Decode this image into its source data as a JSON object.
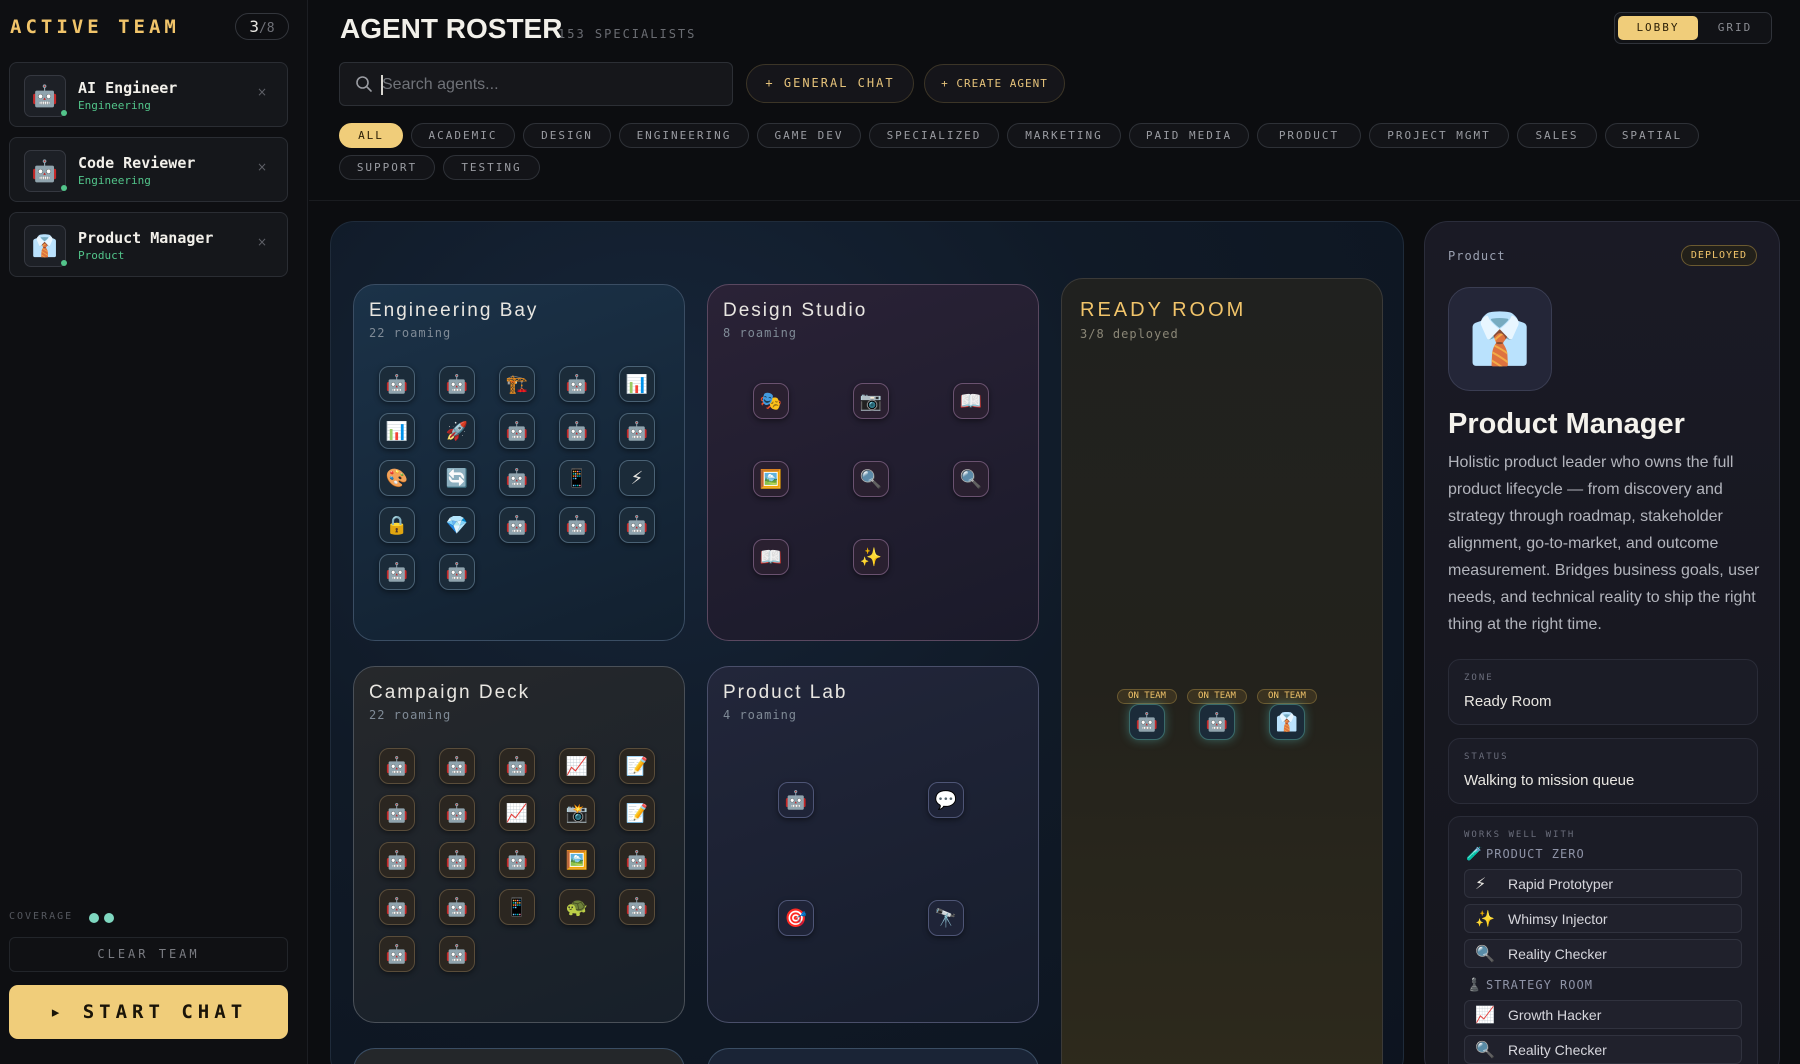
{
  "sidebar": {
    "title": "ACTIVE TEAM",
    "count": "3",
    "count_total": "/8",
    "team": [
      {
        "name": "AI Engineer",
        "dept": "Engineering",
        "icon": "🤖"
      },
      {
        "name": "Code Reviewer",
        "dept": "Engineering",
        "icon": "🤖"
      },
      {
        "name": "Product Manager",
        "dept": "Product",
        "icon": "👔"
      }
    ],
    "remove_glyph": "×",
    "coverage_label": "COVERAGE",
    "clear_label": "CLEAR TEAM",
    "start_label": "▸ START CHAT"
  },
  "header": {
    "title": "AGENT ROSTER",
    "subtitle": "153 SPECIALISTS",
    "search_placeholder": "Search agents...",
    "general_chat": "+ GENERAL CHAT",
    "create_agent": "+ CREATE AGENT",
    "view_lobby": "LOBBY",
    "view_grid": "GRID",
    "filters": [
      "ALL",
      "ACADEMIC",
      "DESIGN",
      "ENGINEERING",
      "GAME DEV",
      "SPECIALIZED",
      "MARKETING",
      "PAID MEDIA",
      "PRODUCT",
      "PROJECT MGMT",
      "SALES",
      "SPATIAL",
      "SUPPORT",
      "TESTING"
    ],
    "active_filter": "ALL"
  },
  "zones": {
    "engineering": {
      "title": "Engineering Bay",
      "sub": "22 roaming",
      "agents": [
        "🤖",
        "🤖",
        "🏗️",
        "🤖",
        "📊",
        "📊",
        "🚀",
        "🤖",
        "🤖",
        "🤖",
        "🎨",
        "🔄",
        "🤖",
        "📱",
        "⚡",
        "🔒",
        "💎",
        "🤖",
        "🤖",
        "🤖",
        "🤖",
        "🤖"
      ]
    },
    "design": {
      "title": "Design Studio",
      "sub": "8 roaming",
      "agents": [
        "🎭",
        "📷",
        "📖",
        "🖼️",
        "🔍",
        "🔍",
        "📖",
        "✨"
      ]
    },
    "campaign": {
      "title": "Campaign Deck",
      "sub": "22 roaming",
      "agents": [
        "🤖",
        "🤖",
        "🤖",
        "📈",
        "📝",
        "🤖",
        "🤖",
        "📈",
        "📸",
        "📝",
        "🤖",
        "🤖",
        "🤖",
        "🖼️",
        "🤖",
        "🤖",
        "🤖",
        "📱",
        "🐢",
        "🤖",
        "🤖",
        "🤖"
      ]
    },
    "product": {
      "title": "Product Lab",
      "sub": "4 roaming",
      "agents": [
        "🤖",
        "💬",
        "🎯",
        "🔭"
      ]
    },
    "ready": {
      "title": "READY ROOM",
      "sub": "3/8 deployed",
      "on_team_label": "ON TEAM",
      "agents": [
        "🤖",
        "🤖",
        "👔"
      ]
    }
  },
  "detail": {
    "category": "Product",
    "badge": "DEPLOYED",
    "icon": "👔",
    "name": "Product Manager",
    "description": "Holistic product leader who owns the full product lifecycle — from discovery and strategy through roadmap, stakeholder alignment, go-to-market, and outcome measurement. Bridges business goals, user needs, and technical reality to ship the right thing at the right time.",
    "zone_label": "ZONE",
    "zone_value": "Ready Room",
    "status_label": "STATUS",
    "status_value": "Walking to mission queue",
    "works_label": "WORKS WELL WITH",
    "groups": [
      {
        "name": "PRODUCT ZERO",
        "icon": "🧪",
        "items": [
          {
            "icon": "⚡",
            "name": "Rapid Prototyper"
          },
          {
            "icon": "✨",
            "name": "Whimsy Injector"
          },
          {
            "icon": "🔍",
            "name": "Reality Checker"
          }
        ]
      },
      {
        "name": "STRATEGY ROOM",
        "icon": "♟️",
        "items": [
          {
            "icon": "📈",
            "name": "Growth Hacker"
          },
          {
            "icon": "🔍",
            "name": "Reality Checker"
          }
        ]
      }
    ]
  },
  "colors": {
    "accent": "#f0cd7a",
    "online": "#52c48a",
    "coverage": "#7fd8c0"
  }
}
